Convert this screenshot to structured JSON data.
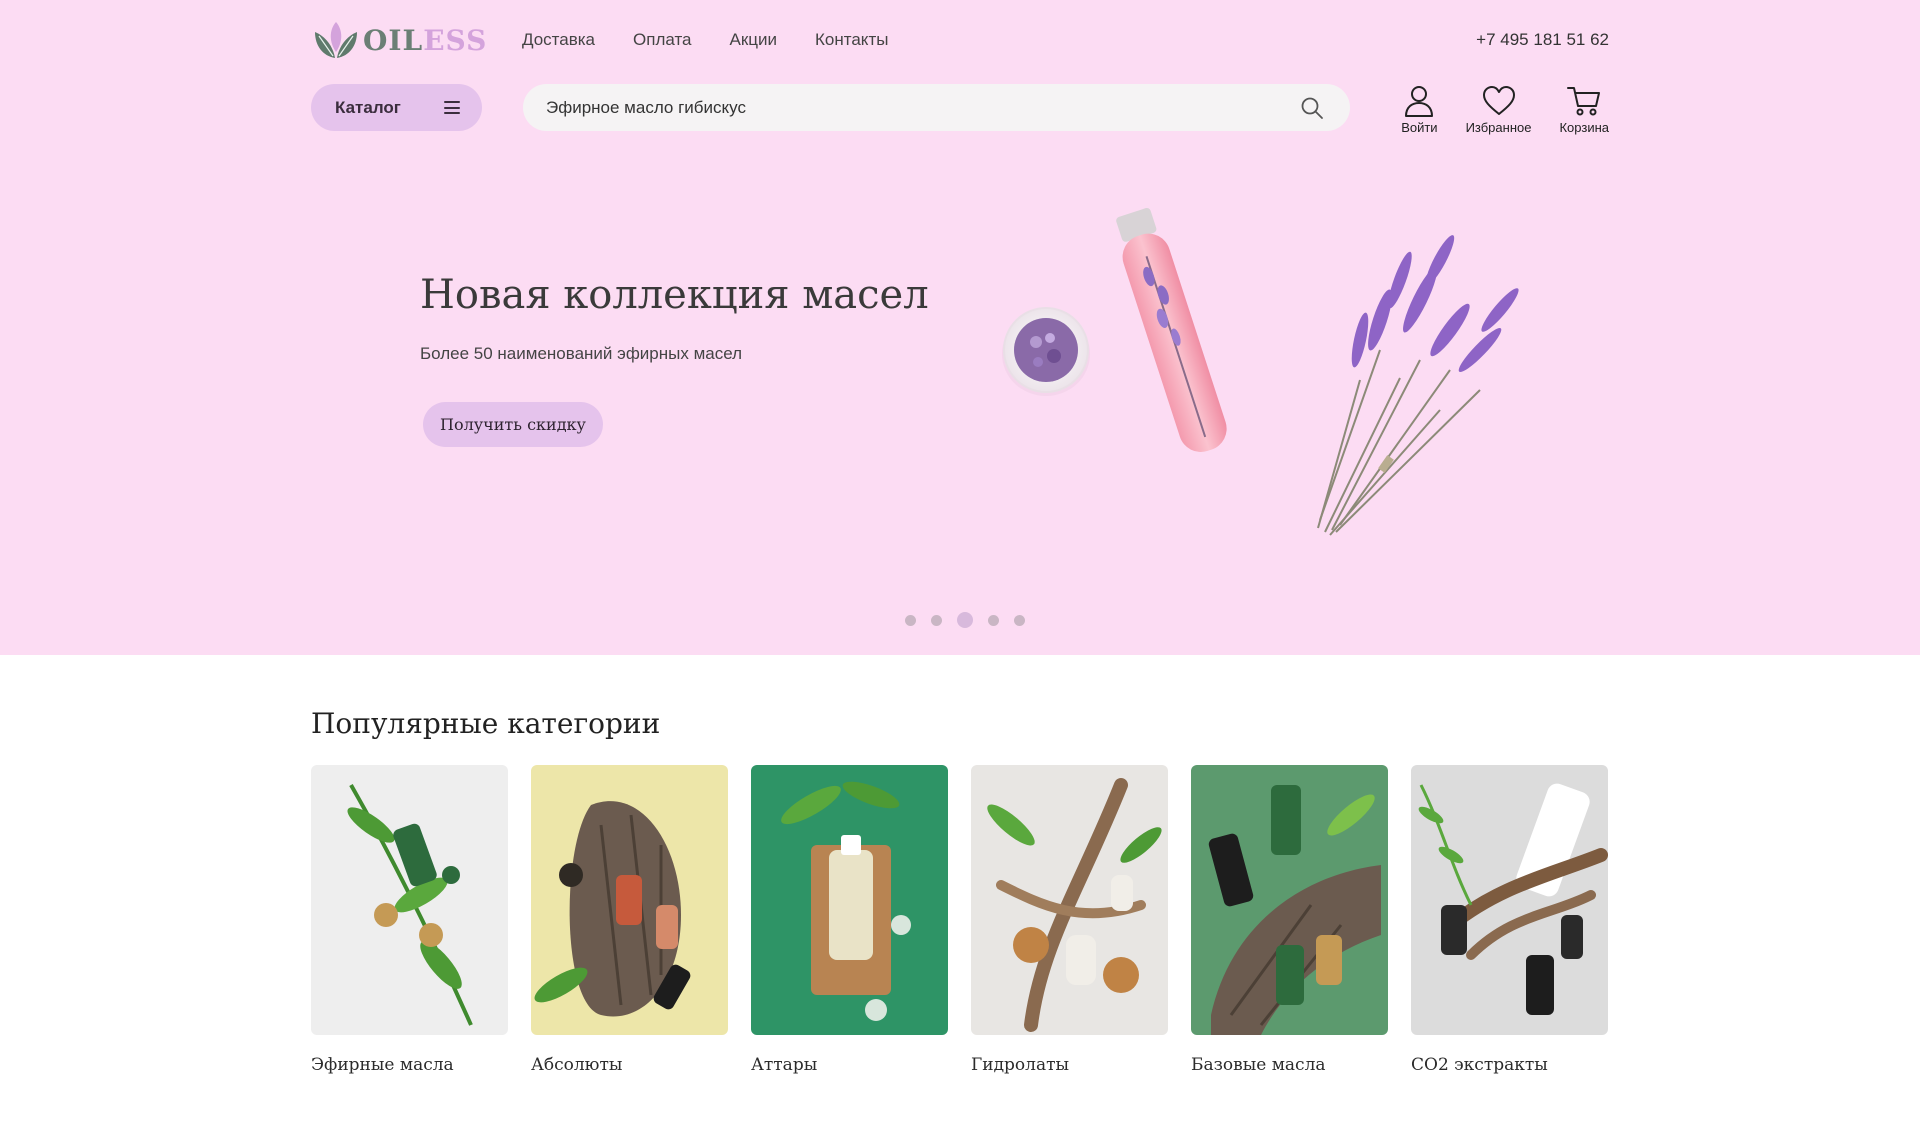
{
  "brand": {
    "logo_left": "OIL",
    "logo_right": "ESS"
  },
  "nav": {
    "items": [
      "Доставка",
      "Оплата",
      "Акции",
      "Контакты"
    ]
  },
  "phone": "+7 495 181 51 62",
  "toolbar": {
    "catalog_label": "Каталог",
    "search_value": "Эфирное масло гибискус"
  },
  "user_actions": {
    "login": "Войти",
    "favorites": "Избранное",
    "cart": "Корзина"
  },
  "hero": {
    "title": "Новая коллекция масел",
    "subtitle": "Более 50 наименований эфирных масел",
    "cta": "Получить скидку",
    "slides_total": 5,
    "active_slide": 3
  },
  "categories": {
    "title": "Популярные категории",
    "items": [
      "Эфирные масла",
      "Абсолюты",
      "Аттары",
      "Гидролаты",
      "Базовые масла",
      "CO2 экстракты"
    ]
  },
  "colors": {
    "hero_bg": "#fcdcf3",
    "accent_lilac": "#e5c3ec",
    "label_highlight": "#c6ecd9"
  }
}
